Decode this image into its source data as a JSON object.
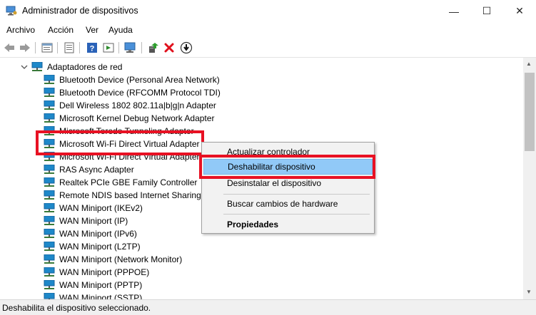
{
  "window": {
    "title": "Administrador de dispositivos",
    "minimize_glyph": "—",
    "maximize_glyph": "☐",
    "close_glyph": "✕"
  },
  "menu": [
    "Archivo",
    "Acción",
    "Ver",
    "Ayuda"
  ],
  "toolbar": {
    "icons": [
      "back-icon",
      "forward-icon",
      "properties-icon",
      "show-hide-icon",
      "help-icon",
      "action-icon",
      "scan-hardware-icon",
      "update-driver-icon",
      "uninstall-icon",
      "disable-icon"
    ]
  },
  "tree": {
    "category": "Adaptadores de red",
    "devices": [
      "Bluetooth Device (Personal Area Network)",
      "Bluetooth Device (RFCOMM Protocol TDI)",
      "Dell Wireless 1802 802.11a|b|g|n Adapter",
      "Microsoft Kernel Debug Network Adapter",
      "Microsoft Teredo Tunneling Adapter",
      "Microsoft Wi-Fi Direct Virtual Adapter",
      "Microsoft Wi-Fi Direct Virtual Adapter",
      "RAS Async Adapter",
      "Realtek PCIe GBE Family Controller",
      "Remote NDIS based Internet Sharing Device",
      "WAN Miniport (IKEv2)",
      "WAN Miniport (IP)",
      "WAN Miniport (IPv6)",
      "WAN Miniport (L2TP)",
      "WAN Miniport (Network Monitor)",
      "WAN Miniport (PPPOE)",
      "WAN Miniport (PPTP)",
      "WAN Miniport (SSTP)"
    ]
  },
  "context_menu": {
    "items": [
      "Actualizar controlador",
      "Deshabilitar dispositivo",
      "Desinstalar el dispositivo",
      "Buscar cambios de hardware",
      "Propiedades"
    ],
    "highlighted": "Deshabilitar dispositivo"
  },
  "status": "Deshabilita el dispositivo seleccionado.",
  "colors": {
    "highlight": "#91c9f7",
    "annotation_red": "#e81123",
    "network_icon": "#1e88c9"
  }
}
